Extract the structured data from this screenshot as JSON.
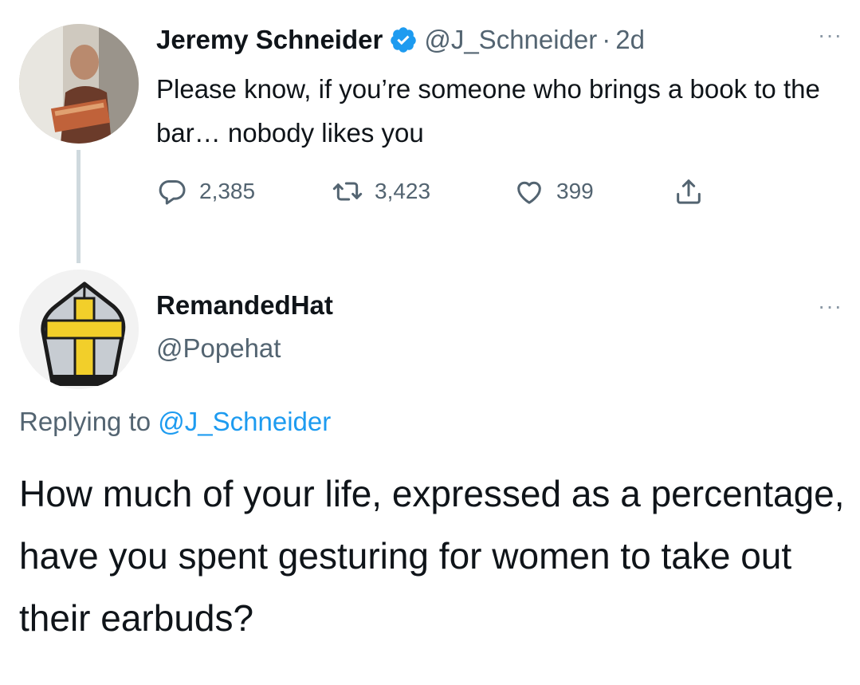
{
  "original_tweet": {
    "author_name": "Jeremy Schneider",
    "verified_icon": "verified-badge-icon",
    "handle": "@J_Schneider",
    "separator": "·",
    "time": "2d",
    "more_label": "···",
    "text": "Please know, if you’re someone who brings a book to the bar… nobody likes you",
    "stats": {
      "replies": "2,385",
      "retweets": "3,423",
      "likes": "399"
    },
    "icons": [
      "reply-icon",
      "retweet-icon",
      "like-icon",
      "share-icon"
    ]
  },
  "reply_tweet": {
    "author_name": "RemandedHat",
    "handle": "@Popehat",
    "more_label": "···",
    "replying_prefix": "Replying to",
    "replying_to": "@J_Schneider",
    "text": "How much of your life, expressed as a percentage, have you spent gesturing for women to take out their earbuds?"
  },
  "colors": {
    "primary_text": "#0f1419",
    "secondary_text": "#536471",
    "link": "#1d9bf0",
    "verified": "#1d9bf0",
    "thread_line": "#cfd9de"
  }
}
